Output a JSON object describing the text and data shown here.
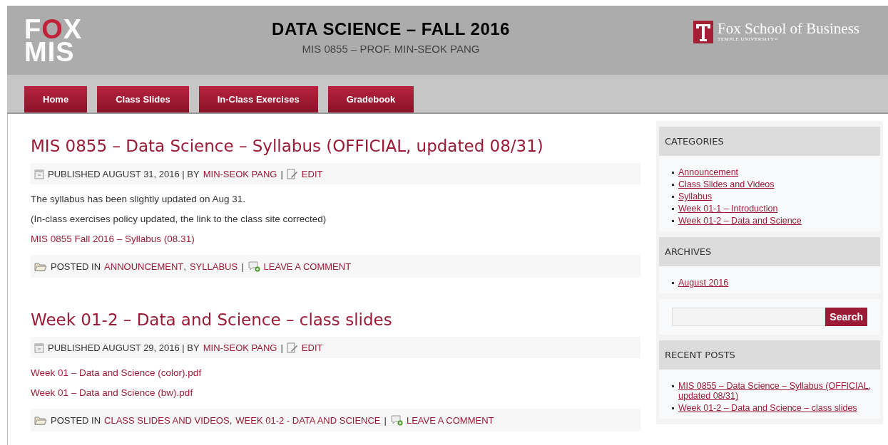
{
  "header": {
    "logo": [
      "FOX",
      "MIS"
    ],
    "title": "DATA SCIENCE – FALL 2016",
    "subtitle": "MIS 0855 – PROF. MIN-SEOK PANG",
    "school": {
      "name": "Fox School of Business",
      "university": "TEMPLE UNIVERSITY®"
    }
  },
  "nav": [
    {
      "label": "Home",
      "selected": false
    },
    {
      "label": "Class Slides",
      "selected": false
    },
    {
      "label": "In-Class Exercises",
      "selected": false
    },
    {
      "label": "Gradebook",
      "selected": false
    }
  ],
  "posts": [
    {
      "title": "MIS 0855 – Data Science – Syllabus (OFFICIAL, updated 08/31)",
      "published": "PUBLISHED AUGUST 31, 2016 | BY",
      "author": "MIN-SEOK PANG",
      "separator": "|",
      "edit": "EDIT",
      "body": [
        {
          "kind": "text",
          "text": "The syllabus has been slightly updated on Aug 31."
        },
        {
          "kind": "text",
          "text": "(In-class exercises policy updated, the link to the class site corrected)"
        },
        {
          "kind": "link",
          "text": "MIS 0855 Fall 2016 – Syllabus (08.31)"
        }
      ],
      "posted_in": "POSTED IN",
      "categories": [
        "ANNOUNCEMENT",
        "SYLLABUS"
      ],
      "category_separator": ",",
      "footer_separator": "|",
      "comment": "LEAVE A COMMENT"
    },
    {
      "title": "Week 01-2 – Data and Science – class slides",
      "published": "PUBLISHED AUGUST 29, 2016 | BY",
      "author": "MIN-SEOK PANG",
      "separator": "|",
      "edit": "EDIT",
      "body": [
        {
          "kind": "link",
          "text": "Week 01 – Data and Science (color).pdf"
        },
        {
          "kind": "link",
          "text": "Week 01 – Data and Science (bw).pdf"
        }
      ],
      "posted_in": "POSTED IN",
      "categories": [
        "CLASS SLIDES AND VIDEOS",
        "WEEK 01-2 - DATA AND SCIENCE"
      ],
      "category_separator": ",",
      "footer_separator": "|",
      "comment": "LEAVE A COMMENT"
    }
  ],
  "sidebar": [
    {
      "kind": "list",
      "title": "CATEGORIES",
      "items": [
        "Announcement",
        "Class Slides and Videos",
        "Syllabus",
        "Week 01-1 – Introduction",
        "Week 01-2 – Data and Science"
      ]
    },
    {
      "kind": "list",
      "title": "ARCHIVES",
      "items": [
        "August 2016"
      ]
    },
    {
      "kind": "search",
      "button": "Search"
    },
    {
      "kind": "list",
      "title": "RECENT POSTS",
      "items": [
        "MIS 0855 – Data Science – Syllabus (OFFICIAL, updated 08/31)",
        "Week 01-2 – Data and Science – class slides"
      ]
    }
  ]
}
